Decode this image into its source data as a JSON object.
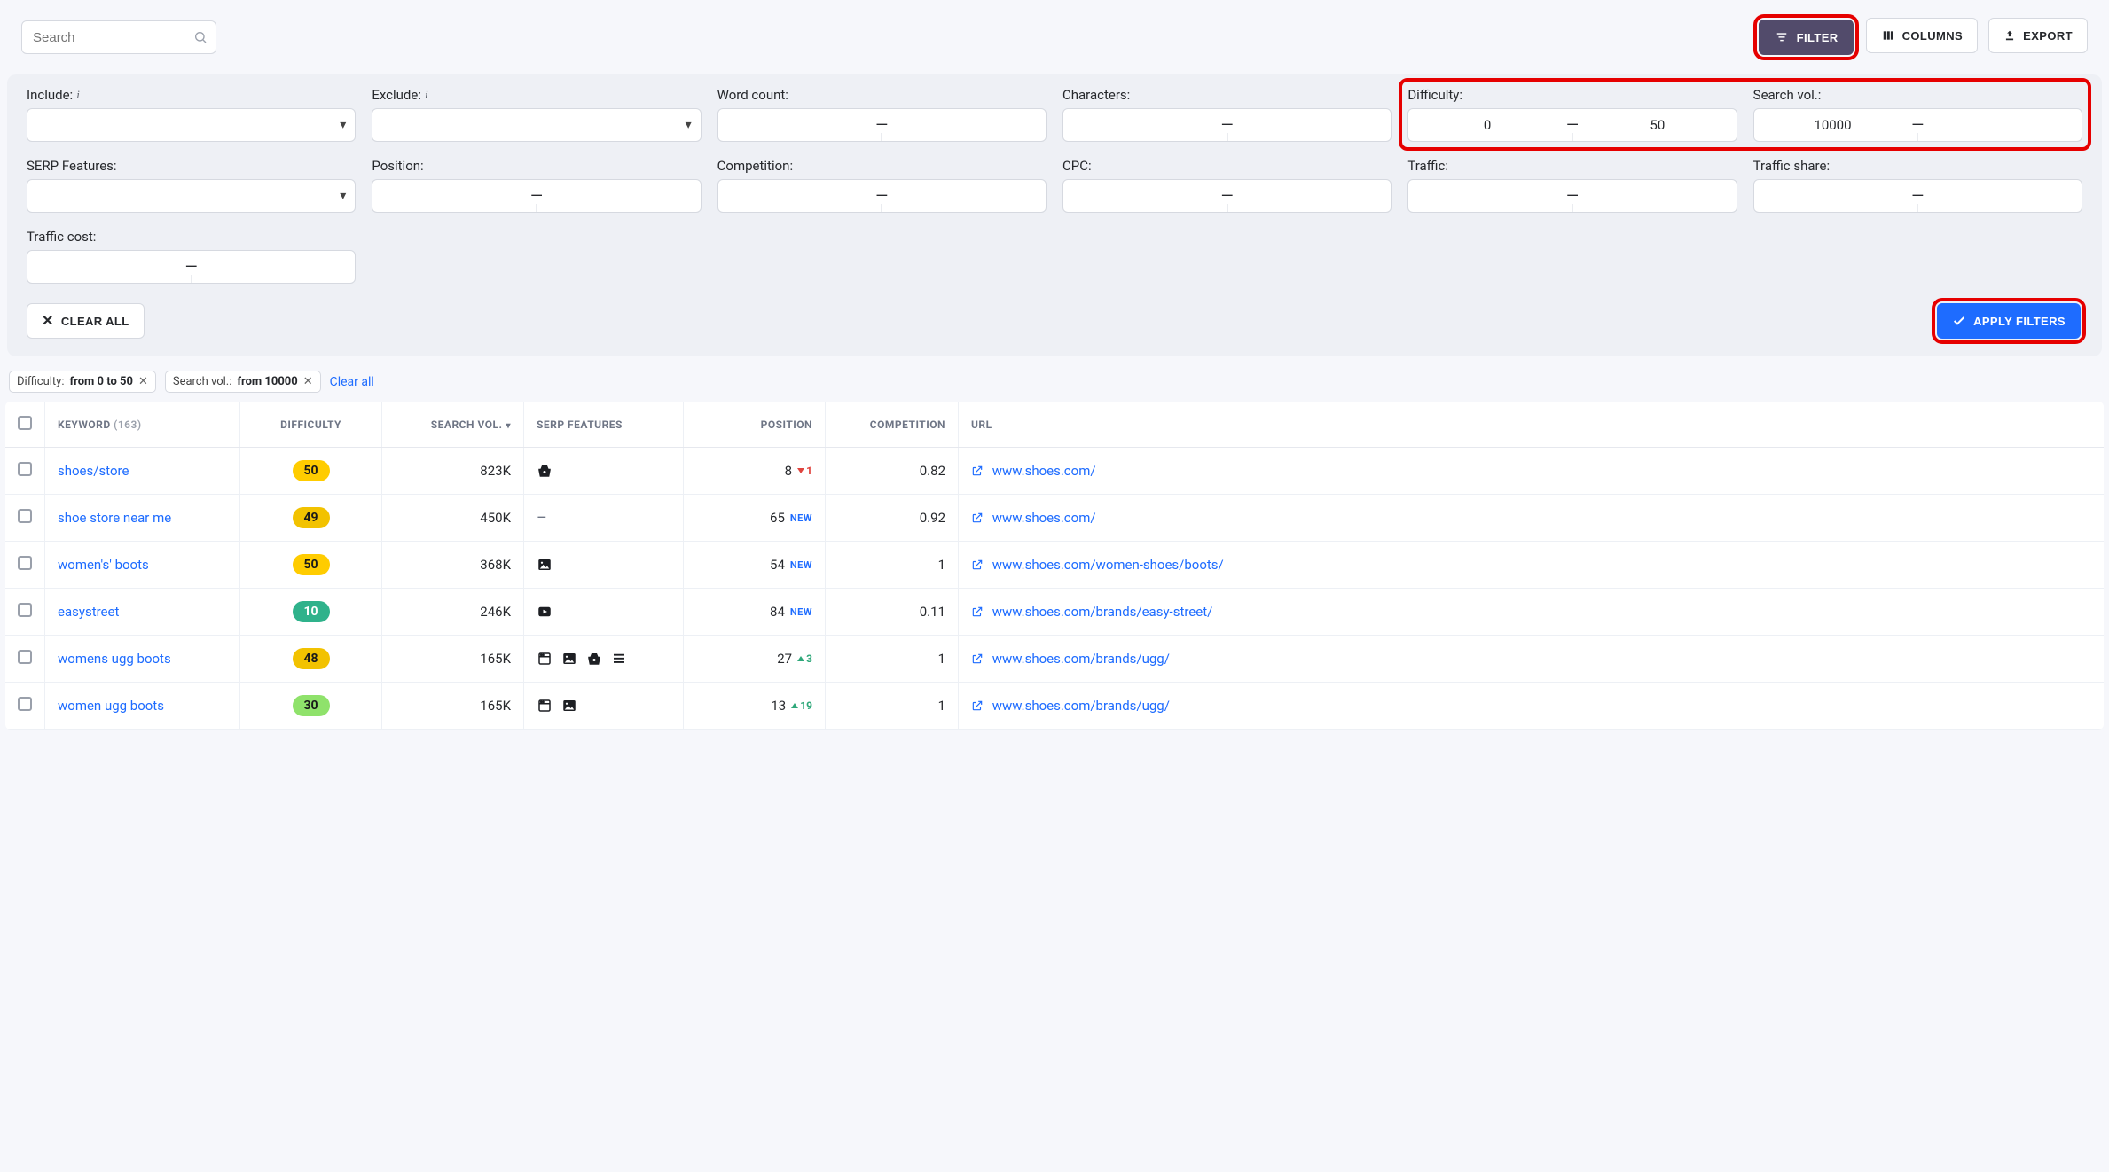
{
  "topbar": {
    "search_placeholder": "Search",
    "filter_label": "FILTER",
    "columns_label": "COLUMNS",
    "export_label": "EXPORT"
  },
  "filters": {
    "include_label": "Include:",
    "exclude_label": "Exclude:",
    "wordcount_label": "Word count:",
    "characters_label": "Characters:",
    "difficulty_label": "Difficulty:",
    "searchvol_label": "Search vol.:",
    "serp_label": "SERP Features:",
    "position_label": "Position:",
    "competition_label": "Competition:",
    "cpc_label": "CPC:",
    "traffic_label": "Traffic:",
    "trafficshare_label": "Traffic share:",
    "trafficcost_label": "Traffic cost:",
    "dash": "—",
    "difficulty_min": "0",
    "difficulty_max": "50",
    "searchvol_min": "10000",
    "clear_all_label": "CLEAR ALL",
    "apply_label": "APPLY FILTERS"
  },
  "chips": {
    "difficulty_label": "Difficulty:",
    "difficulty_value": "from 0 to 50",
    "searchvol_label": "Search vol.:",
    "searchvol_value": "from 10000",
    "clear_all": "Clear all"
  },
  "table": {
    "headers": {
      "keyword": "KEYWORD",
      "keyword_count": "(163)",
      "difficulty": "DIFFICULTY",
      "searchvol": "SEARCH VOL.",
      "serp": "SERP FEATURES",
      "position": "POSITION",
      "competition": "COMPETITION",
      "url": "URL"
    },
    "rows": [
      {
        "kw": "shoes/store",
        "diff": "50",
        "diff_class": "b-yellow",
        "vol": "823K",
        "serp": [
          "basket"
        ],
        "pos": "8",
        "pos_delta": "1",
        "pos_dir": "down",
        "comp": "0.82",
        "url": "www.shoes.com/"
      },
      {
        "kw": "shoe store near me",
        "diff": "49",
        "diff_class": "b-yellowd",
        "vol": "450K",
        "serp": [
          "dash"
        ],
        "pos": "65",
        "pos_delta": "NEW",
        "pos_dir": "new",
        "comp": "0.92",
        "url": "www.shoes.com/"
      },
      {
        "kw": "women's' boots",
        "diff": "50",
        "diff_class": "b-yellow",
        "vol": "368K",
        "serp": [
          "image"
        ],
        "pos": "54",
        "pos_delta": "NEW",
        "pos_dir": "new",
        "comp": "1",
        "url": "www.shoes.com/women-shoes/boots/"
      },
      {
        "kw": "easystreet",
        "diff": "10",
        "diff_class": "b-green",
        "vol": "246K",
        "serp": [
          "video"
        ],
        "pos": "84",
        "pos_delta": "NEW",
        "pos_dir": "new",
        "comp": "0.11",
        "url": "www.shoes.com/brands/easy-street/"
      },
      {
        "kw": "womens ugg boots",
        "diff": "48",
        "diff_class": "b-yellowd",
        "vol": "165K",
        "serp": [
          "sitelinks",
          "image",
          "basket",
          "list"
        ],
        "pos": "27",
        "pos_delta": "3",
        "pos_dir": "up",
        "comp": "1",
        "url": "www.shoes.com/brands/ugg/"
      },
      {
        "kw": "women ugg boots",
        "diff": "30",
        "diff_class": "b-lime",
        "vol": "165K",
        "serp": [
          "sitelinks",
          "image"
        ],
        "pos": "13",
        "pos_delta": "19",
        "pos_dir": "up",
        "comp": "1",
        "url": "www.shoes.com/brands/ugg/"
      }
    ]
  }
}
